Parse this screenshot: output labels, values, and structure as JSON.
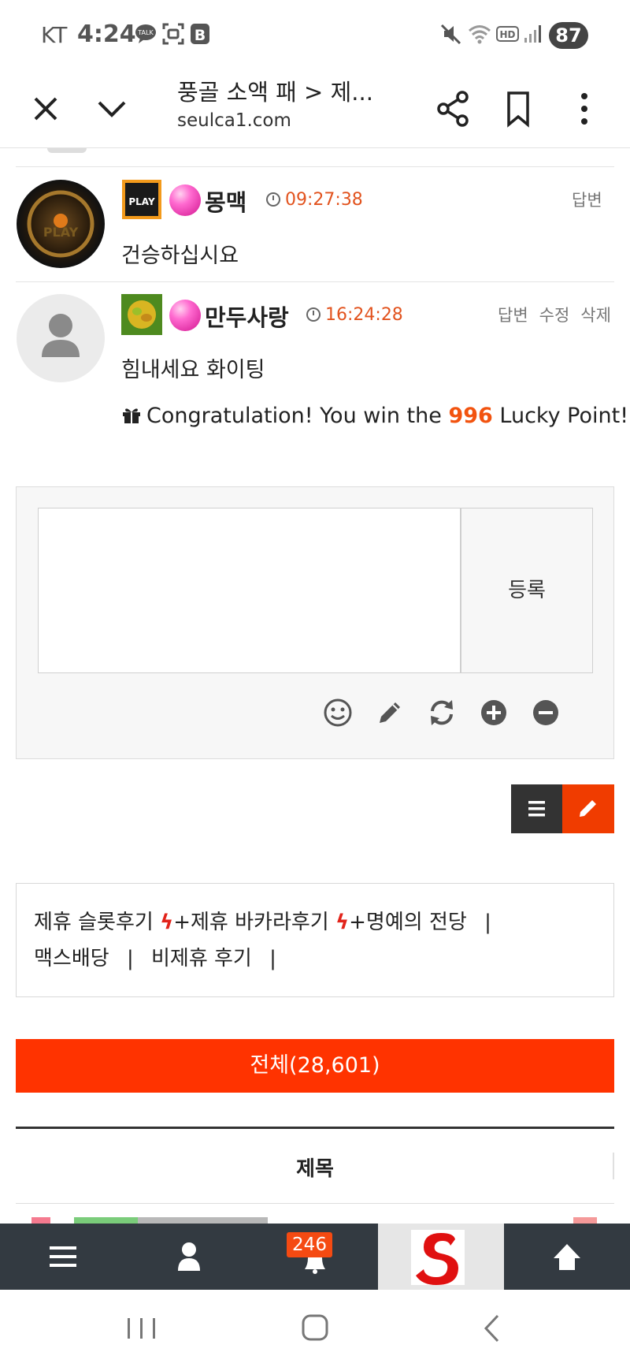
{
  "status_bar": {
    "carrier": "KT",
    "time": "4:24",
    "battery": "87",
    "icons": [
      "kakaotalk-icon",
      "screenshot-icon",
      "b-app-icon",
      "mute-icon",
      "wifi-icon",
      "hd-icon",
      "signal-icon"
    ]
  },
  "browser": {
    "title": "풍골 소액 패 > 제...",
    "url": "seulca1.com",
    "icons": [
      "close-icon",
      "chevron-down-icon",
      "share-icon",
      "bookmark-icon",
      "more-icon"
    ]
  },
  "comments": [
    {
      "nickname": "몽맥",
      "time": "09:27:38",
      "actions": [
        "답변"
      ],
      "text": "건승하십시요",
      "level_badge": "PLAY"
    },
    {
      "nickname": "만두사랑",
      "time": "16:24:28",
      "actions": [
        "답변",
        "수정",
        "삭제"
      ],
      "text": "힘내세요 화이팅"
    }
  ],
  "lucky": {
    "prefix": "Congratulation! You win the ",
    "points": "996",
    "suffix": " Lucky Point!"
  },
  "comment_form": {
    "submit_label": "등록",
    "tools": [
      "emoji-icon",
      "pencil-icon",
      "refresh-icon",
      "plus-circle-icon",
      "minus-circle-icon"
    ]
  },
  "categories": {
    "line1": [
      "제휴 슬롯후기",
      "+제휴 바카라후기",
      "+명예의 전당"
    ],
    "line2": [
      "맥스배당",
      "비제휴 후기"
    ],
    "separator": "|"
  },
  "all_button_label": "전체(28,601)",
  "table_header_title": "제목",
  "site_nav": {
    "notification_count": "246",
    "icons": [
      "menu-icon",
      "user-icon",
      "bell-icon",
      "site-logo",
      "arrow-up-icon"
    ]
  },
  "colors": {
    "accent": "#ff3300",
    "time": "#e2531e",
    "nav_bg": "#333a41"
  }
}
